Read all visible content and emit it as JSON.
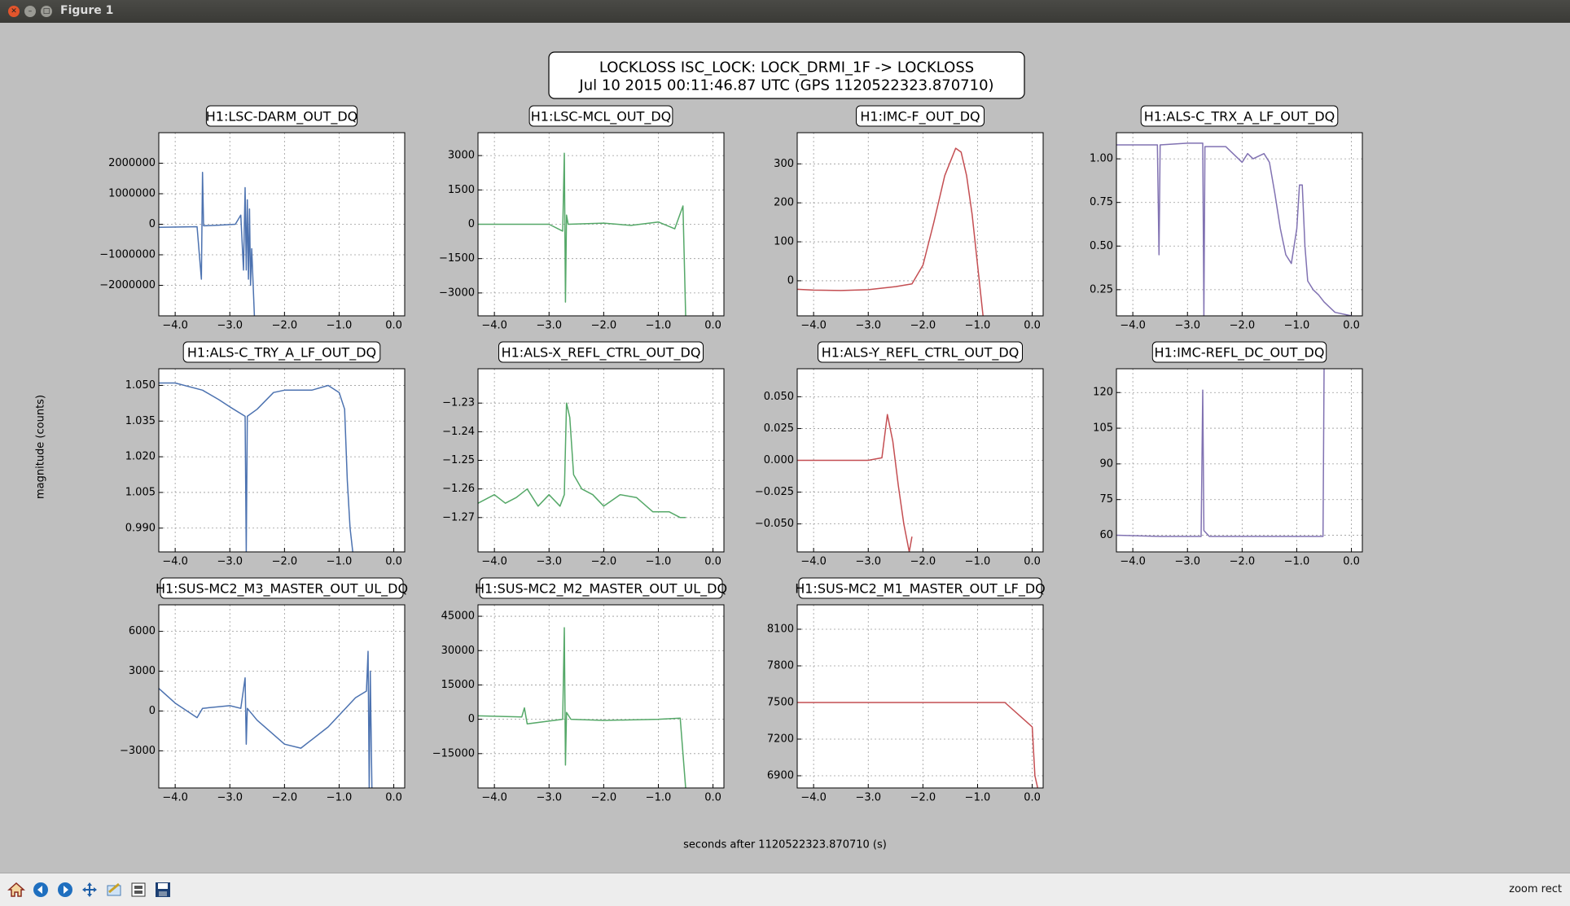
{
  "window": {
    "title": "Figure 1"
  },
  "figure": {
    "title_line1": "LOCKLOSS ISC_LOCK: LOCK_DRMI_1F -> LOCKLOSS",
    "title_line2": "Jul 10 2015 00:11:46.87 UTC (GPS 1120522323.870710)",
    "xlabel": "seconds after 1120522323.870710 (s)",
    "ylabel": "magnitude (counts)"
  },
  "toolbar": {
    "buttons": [
      "home-icon",
      "back-arrow-icon",
      "forward-arrow-icon",
      "pan-icon",
      "zoom-icon",
      "subplots-icon",
      "save-icon"
    ],
    "status": "zoom rect"
  },
  "colors": {
    "blue": "#4c72b0",
    "green": "#55a868",
    "red": "#c44e52",
    "purple": "#8172b2"
  },
  "chart_data": [
    {
      "type": "line",
      "title": "H1:LSC-DARM_OUT_DQ",
      "color": "blue",
      "xlim": [
        -4.3,
        0.2
      ],
      "ylim": [
        -3000000,
        3000000
      ],
      "yticks": [
        2000000,
        1000000,
        0,
        -1000000,
        -2000000
      ],
      "ytick_labels": [
        "2000000",
        "1000000",
        "0",
        "−1000000",
        "−2000000"
      ],
      "xticks": [
        -4.0,
        -3.0,
        -2.0,
        -1.0,
        0.0
      ],
      "xtick_labels": [
        "−4.0",
        "−3.0",
        "−2.0",
        "−1.0",
        "0.0"
      ],
      "x": [
        -4.3,
        -3.6,
        -3.52,
        -3.5,
        -3.48,
        -3.2,
        -2.9,
        -2.8,
        -2.75,
        -2.72,
        -2.7,
        -2.68,
        -2.66,
        -2.64,
        -2.62,
        -2.6,
        -2.55
      ],
      "y": [
        -100000,
        -80000,
        -1800000,
        1700000,
        -50000,
        -30000,
        0,
        300000,
        -1500000,
        1200000,
        -1500000,
        800000,
        -1800000,
        500000,
        -2000000,
        -800000,
        -3000000
      ]
    },
    {
      "type": "line",
      "title": "H1:LSC-MCL_OUT_DQ",
      "color": "green",
      "xlim": [
        -4.3,
        0.2
      ],
      "ylim": [
        -4000,
        4000
      ],
      "yticks": [
        3000,
        1500,
        0,
        -1500,
        -3000
      ],
      "ytick_labels": [
        "3000",
        "1500",
        "0",
        "−1500",
        "−3000"
      ],
      "xticks": [
        -4.0,
        -3.0,
        -2.0,
        -1.0,
        0.0
      ],
      "xtick_labels": [
        "−4.0",
        "−3.0",
        "−2.0",
        "−1.0",
        "0.0"
      ],
      "x": [
        -4.3,
        -3.0,
        -2.75,
        -2.72,
        -2.7,
        -2.68,
        -2.65,
        -2.0,
        -1.5,
        -1.0,
        -0.7,
        -0.55,
        -0.5
      ],
      "y": [
        0,
        0,
        -300,
        3100,
        -3400,
        400,
        0,
        50,
        -50,
        100,
        -200,
        800,
        -4000
      ]
    },
    {
      "type": "line",
      "title": "H1:IMC-F_OUT_DQ",
      "color": "red",
      "xlim": [
        -4.3,
        0.2
      ],
      "ylim": [
        -90,
        380
      ],
      "yticks": [
        300,
        200,
        100,
        0
      ],
      "ytick_labels": [
        "300",
        "200",
        "100",
        "0"
      ],
      "xticks": [
        -4.0,
        -3.0,
        -2.0,
        -1.0,
        0.0
      ],
      "xtick_labels": [
        "−4.0",
        "−3.0",
        "−2.0",
        "−1.0",
        "0.0"
      ],
      "x": [
        -4.3,
        -4.0,
        -3.5,
        -3.0,
        -2.5,
        -2.2,
        -2.0,
        -1.8,
        -1.6,
        -1.4,
        -1.3,
        -1.2,
        -1.1,
        -1.0,
        -0.9
      ],
      "y": [
        -22,
        -24,
        -25,
        -23,
        -15,
        -8,
        40,
        150,
        270,
        340,
        330,
        270,
        170,
        40,
        -90
      ]
    },
    {
      "type": "line",
      "title": "H1:ALS-C_TRX_A_LF_OUT_DQ",
      "color": "purple",
      "xlim": [
        -4.3,
        0.2
      ],
      "ylim": [
        0.1,
        1.15
      ],
      "yticks": [
        1.0,
        0.75,
        0.5,
        0.25
      ],
      "ytick_labels": [
        "1.00",
        "0.75",
        "0.50",
        "0.25"
      ],
      "xticks": [
        -4.0,
        -3.0,
        -2.0,
        -1.0,
        0.0
      ],
      "xtick_labels": [
        "−4.0",
        "−3.0",
        "−2.0",
        "−1.0",
        "0.0"
      ],
      "x": [
        -4.3,
        -3.6,
        -3.55,
        -3.52,
        -3.5,
        -3.0,
        -2.72,
        -2.7,
        -2.68,
        -2.3,
        -2.0,
        -1.9,
        -1.8,
        -1.6,
        -1.5,
        -1.4,
        -1.3,
        -1.2,
        -1.1,
        -1.0,
        -0.95,
        -0.9,
        -0.85,
        -0.8,
        -0.7,
        -0.6,
        -0.5,
        -0.3,
        0.0,
        0.2
      ],
      "y": [
        1.08,
        1.08,
        1.08,
        0.45,
        1.08,
        1.09,
        1.09,
        0.1,
        1.07,
        1.07,
        0.98,
        1.03,
        1.0,
        1.03,
        0.98,
        0.8,
        0.6,
        0.45,
        0.4,
        0.6,
        0.85,
        0.85,
        0.5,
        0.3,
        0.25,
        0.22,
        0.18,
        0.12,
        0.1,
        0.08
      ]
    },
    {
      "type": "line",
      "title": "H1:ALS-C_TRY_A_LF_OUT_DQ",
      "color": "blue",
      "xlim": [
        -4.3,
        0.2
      ],
      "ylim": [
        0.98,
        1.057
      ],
      "yticks": [
        1.05,
        1.035,
        1.02,
        1.005,
        0.99
      ],
      "ytick_labels": [
        "1.050",
        "1.035",
        "1.020",
        "1.005",
        "0.990"
      ],
      "xticks": [
        -4.0,
        -3.0,
        -2.0,
        -1.0,
        0.0
      ],
      "xtick_labels": [
        "−4.0",
        "−3.0",
        "−2.0",
        "−1.0",
        "0.0"
      ],
      "x": [
        -4.3,
        -4.0,
        -3.5,
        -3.2,
        -3.0,
        -2.72,
        -2.7,
        -2.68,
        -2.5,
        -2.2,
        -2.0,
        -1.5,
        -1.2,
        -1.0,
        -0.9,
        -0.85,
        -0.8,
        -0.75
      ],
      "y": [
        1.051,
        1.051,
        1.048,
        1.044,
        1.041,
        1.037,
        0.98,
        1.037,
        1.04,
        1.047,
        1.048,
        1.048,
        1.05,
        1.047,
        1.04,
        1.01,
        0.99,
        0.98
      ]
    },
    {
      "type": "line",
      "title": "H1:ALS-X_REFL_CTRL_OUT_DQ",
      "color": "green",
      "xlim": [
        -4.3,
        0.2
      ],
      "ylim": [
        -1.282,
        -1.218
      ],
      "yticks": [
        -1.23,
        -1.24,
        -1.25,
        -1.26,
        -1.27
      ],
      "ytick_labels": [
        "−1.23",
        "−1.24",
        "−1.25",
        "−1.26",
        "−1.27"
      ],
      "xticks": [
        -4.0,
        -3.0,
        -2.0,
        -1.0,
        0.0
      ],
      "xtick_labels": [
        "−4.0",
        "−3.0",
        "−2.0",
        "−1.0",
        "0.0"
      ],
      "x": [
        -4.3,
        -4.0,
        -3.8,
        -3.6,
        -3.4,
        -3.2,
        -3.0,
        -2.8,
        -2.72,
        -2.68,
        -2.62,
        -2.55,
        -2.4,
        -2.2,
        -2.0,
        -1.7,
        -1.4,
        -1.1,
        -0.8,
        -0.6,
        -0.5
      ],
      "y": [
        -1.265,
        -1.262,
        -1.265,
        -1.263,
        -1.26,
        -1.266,
        -1.262,
        -1.266,
        -1.262,
        -1.23,
        -1.235,
        -1.255,
        -1.26,
        -1.262,
        -1.266,
        -1.262,
        -1.263,
        -1.268,
        -1.268,
        -1.27,
        -1.27
      ]
    },
    {
      "type": "line",
      "title": "H1:ALS-Y_REFL_CTRL_OUT_DQ",
      "color": "red",
      "xlim": [
        -4.3,
        0.2
      ],
      "ylim": [
        -0.072,
        0.072
      ],
      "yticks": [
        0.05,
        0.025,
        0.0,
        -0.025,
        -0.05
      ],
      "ytick_labels": [
        "0.050",
        "0.025",
        "0.000",
        "−0.025",
        "−0.050"
      ],
      "xticks": [
        -4.0,
        -3.0,
        -2.0,
        -1.0,
        0.0
      ],
      "xtick_labels": [
        "−4.0",
        "−3.0",
        "−2.0",
        "−1.0",
        "0.0"
      ],
      "x": [
        -4.3,
        -3.5,
        -3.0,
        -2.75,
        -2.65,
        -2.55,
        -2.45,
        -2.35,
        -2.25,
        -2.2
      ],
      "y": [
        0.0,
        0.0,
        0.0,
        0.002,
        0.036,
        0.015,
        -0.02,
        -0.05,
        -0.072,
        -0.06
      ]
    },
    {
      "type": "line",
      "title": "H1:IMC-REFL_DC_OUT_DQ",
      "color": "purple",
      "xlim": [
        -4.3,
        0.2
      ],
      "ylim": [
        53,
        130
      ],
      "yticks": [
        120,
        105,
        90,
        75,
        60
      ],
      "ytick_labels": [
        "120",
        "105",
        "90",
        "75",
        "60"
      ],
      "xticks": [
        -4.0,
        -3.0,
        -2.0,
        -1.0,
        0.0
      ],
      "xtick_labels": [
        "−4.0",
        "−3.0",
        "−2.0",
        "−1.0",
        "0.0"
      ],
      "x": [
        -4.3,
        -3.5,
        -2.75,
        -2.72,
        -2.7,
        -2.6,
        -2.0,
        -1.0,
        -0.52,
        -0.5
      ],
      "y": [
        60,
        59.5,
        59.5,
        121,
        62,
        59.5,
        59.5,
        59.5,
        59.5,
        130
      ]
    },
    {
      "type": "line",
      "title": "H1:SUS-MC2_M3_MASTER_OUT_UL_DQ",
      "color": "blue",
      "xlim": [
        -4.3,
        0.2
      ],
      "ylim": [
        -5800,
        8000
      ],
      "yticks": [
        6000,
        3000,
        0,
        -3000
      ],
      "ytick_labels": [
        "6000",
        "3000",
        "0",
        "−3000"
      ],
      "xticks": [
        -4.0,
        -3.0,
        -2.0,
        -1.0,
        0.0
      ],
      "xtick_labels": [
        "−4.0",
        "−3.0",
        "−2.0",
        "−1.0",
        "0.0"
      ],
      "x": [
        -4.3,
        -4.0,
        -3.6,
        -3.5,
        -3.0,
        -2.8,
        -2.72,
        -2.7,
        -2.68,
        -2.5,
        -2.0,
        -1.7,
        -1.2,
        -0.7,
        -0.5,
        -0.47,
        -0.45,
        -0.43,
        -0.4
      ],
      "y": [
        1700,
        600,
        -500,
        200,
        400,
        200,
        2500,
        -2500,
        200,
        -700,
        -2500,
        -2800,
        -1200,
        1000,
        1500,
        4500,
        -5800,
        3000,
        -5800
      ]
    },
    {
      "type": "line",
      "title": "H1:SUS-MC2_M2_MASTER_OUT_UL_DQ",
      "color": "green",
      "xlim": [
        -4.3,
        0.2
      ],
      "ylim": [
        -30000,
        50000
      ],
      "yticks": [
        45000,
        30000,
        15000,
        0,
        -15000
      ],
      "ytick_labels": [
        "45000",
        "30000",
        "15000",
        "0",
        "−15000"
      ],
      "xticks": [
        -4.0,
        -3.0,
        -2.0,
        -1.0,
        0.0
      ],
      "xtick_labels": [
        "−4.0",
        "−3.0",
        "−2.0",
        "−1.0",
        "0.0"
      ],
      "x": [
        -4.3,
        -3.5,
        -3.45,
        -3.4,
        -2.75,
        -2.72,
        -2.7,
        -2.68,
        -2.6,
        -2.0,
        -1.0,
        -0.6,
        -0.5
      ],
      "y": [
        1500,
        1000,
        5000,
        -2000,
        0,
        40000,
        -20000,
        3000,
        0,
        -500,
        0,
        500,
        -30000
      ]
    },
    {
      "type": "line",
      "title": "H1:SUS-MC2_M1_MASTER_OUT_LF_DQ",
      "color": "red",
      "xlim": [
        -4.3,
        0.2
      ],
      "ylim": [
        6800,
        8300
      ],
      "yticks": [
        8100,
        7800,
        7500,
        7200,
        6900
      ],
      "ytick_labels": [
        "8100",
        "7800",
        "7500",
        "7200",
        "6900"
      ],
      "xticks": [
        -4.0,
        -3.0,
        -2.0,
        -1.0,
        0.0
      ],
      "xtick_labels": [
        "−4.0",
        "−3.0",
        "−2.0",
        "−1.0",
        "0.0"
      ],
      "x": [
        -4.3,
        -3.0,
        -1.5,
        -0.5,
        0.0,
        0.05,
        0.1
      ],
      "y": [
        7500,
        7500,
        7500,
        7500,
        7300,
        6900,
        6800
      ]
    }
  ]
}
